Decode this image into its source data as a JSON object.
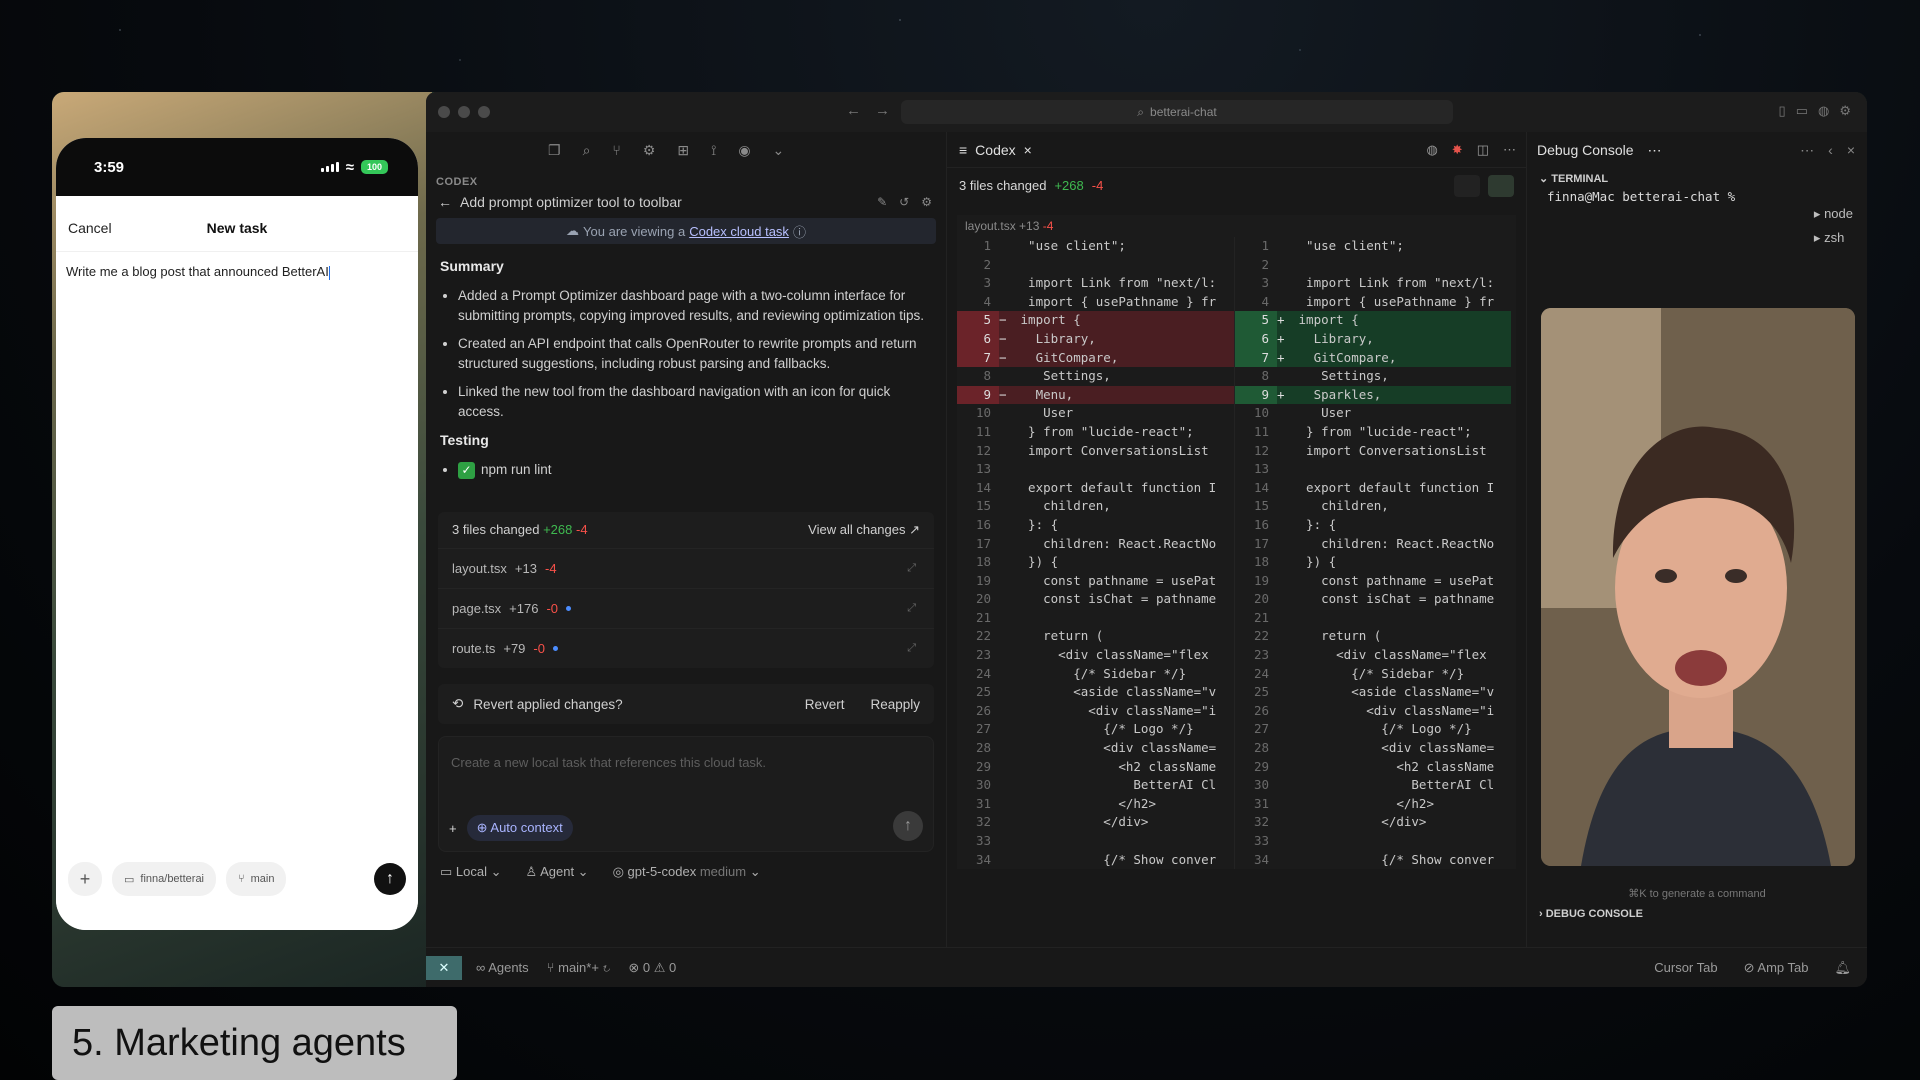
{
  "caption": "5. Marketing agents",
  "phone": {
    "time": "3:59",
    "battery": "100",
    "cancel": "Cancel",
    "title": "New task",
    "prompt": "Write me a blog post that announced BetterAI",
    "repo_chip": "finna/betterai",
    "branch_chip": "main"
  },
  "titlebar": {
    "search": "betterai-chat"
  },
  "codex": {
    "section_label": "CODEX",
    "task_title": "Add prompt optimizer tool to toolbar",
    "cloud_prefix": "You are viewing a",
    "cloud_link": "Codex cloud task",
    "summary_heading": "Summary",
    "summary_items": [
      "Added a Prompt Optimizer dashboard page with a two-column interface for submitting prompts, copying improved results, and reviewing optimization tips.",
      "Created an API endpoint that calls OpenRouter to rewrite prompts and return structured suggestions, including robust parsing and fallbacks.",
      "Linked the new tool from the dashboard navigation with an icon for quick access."
    ],
    "testing_heading": "Testing",
    "testing_item": "npm run lint",
    "files_changed": "3 files changed",
    "files_add": "+268",
    "files_del": "-4",
    "view_all": "View all changes ↗",
    "files": [
      {
        "name": "layout.tsx",
        "add": "+13",
        "del": "-4"
      },
      {
        "name": "page.tsx",
        "add": "+176",
        "del": "-0"
      },
      {
        "name": "route.ts",
        "add": "+79",
        "del": "-0"
      }
    ],
    "revert_question": "Revert applied changes?",
    "revert": "Revert",
    "reapply": "Reapply",
    "compose_placeholder": "Create a new local task that references this cloud task.",
    "auto_context": "Auto context",
    "mode_local": "Local",
    "mode_agent": "Agent",
    "model": "gpt-5-codex",
    "model_effort": "medium"
  },
  "diff": {
    "tab": "Codex",
    "files_changed": "3 files changed",
    "add": "+268",
    "del": "-4",
    "file": "layout.tsx",
    "file_add": "+13",
    "file_del": "-4",
    "left_lines": [
      {
        "n": "1",
        "t": "  \"use client\";",
        "k": ""
      },
      {
        "n": "2",
        "t": "",
        "k": ""
      },
      {
        "n": "3",
        "t": "  import Link from \"next/l:",
        "k": ""
      },
      {
        "n": "4",
        "t": "  import { usePathname } fr",
        "k": ""
      },
      {
        "n": "5",
        "t": " import {",
        "k": "rem"
      },
      {
        "n": "6",
        "t": "   Library,",
        "k": "rem"
      },
      {
        "n": "7",
        "t": "   GitCompare,",
        "k": "rem"
      },
      {
        "n": "8",
        "t": "    Settings,",
        "k": ""
      },
      {
        "n": "9",
        "t": "   Menu,",
        "k": "rem"
      },
      {
        "n": "10",
        "t": "    User",
        "k": ""
      },
      {
        "n": "11",
        "t": "  } from \"lucide-react\";",
        "k": ""
      },
      {
        "n": "12",
        "t": "  import ConversationsList",
        "k": ""
      },
      {
        "n": "13",
        "t": "",
        "k": ""
      },
      {
        "n": "14",
        "t": "  export default function I",
        "k": ""
      },
      {
        "n": "15",
        "t": "    children,",
        "k": ""
      },
      {
        "n": "16",
        "t": "  }: {",
        "k": ""
      },
      {
        "n": "17",
        "t": "    children: React.ReactNo",
        "k": ""
      },
      {
        "n": "18",
        "t": "  }) {",
        "k": ""
      },
      {
        "n": "19",
        "t": "    const pathname = usePat",
        "k": ""
      },
      {
        "n": "20",
        "t": "    const isChat = pathname",
        "k": ""
      },
      {
        "n": "21",
        "t": "",
        "k": ""
      },
      {
        "n": "22",
        "t": "    return (",
        "k": ""
      },
      {
        "n": "23",
        "t": "      <div className=\"flex",
        "k": ""
      },
      {
        "n": "24",
        "t": "        {/* Sidebar */}",
        "k": ""
      },
      {
        "n": "25",
        "t": "        <aside className=\"v",
        "k": ""
      },
      {
        "n": "26",
        "t": "          <div className=\"i",
        "k": ""
      },
      {
        "n": "27",
        "t": "            {/* Logo */}",
        "k": ""
      },
      {
        "n": "28",
        "t": "            <div className=",
        "k": ""
      },
      {
        "n": "29",
        "t": "              <h2 className",
        "k": ""
      },
      {
        "n": "30",
        "t": "                BetterAI Cl",
        "k": ""
      },
      {
        "n": "31",
        "t": "              </h2>",
        "k": ""
      },
      {
        "n": "32",
        "t": "            </div>",
        "k": ""
      },
      {
        "n": "33",
        "t": "",
        "k": ""
      },
      {
        "n": "34",
        "t": "            {/* Show conver",
        "k": ""
      }
    ],
    "right_lines": [
      {
        "n": "1",
        "t": "  \"use client\";",
        "k": ""
      },
      {
        "n": "2",
        "t": "",
        "k": ""
      },
      {
        "n": "3",
        "t": "  import Link from \"next/l:",
        "k": ""
      },
      {
        "n": "4",
        "t": "  import { usePathname } fr",
        "k": ""
      },
      {
        "n": "5",
        "t": " import {",
        "k": "add"
      },
      {
        "n": "6",
        "t": "   Library,",
        "k": "add"
      },
      {
        "n": "7",
        "t": "   GitCompare,",
        "k": "add"
      },
      {
        "n": "8",
        "t": "    Settings,",
        "k": ""
      },
      {
        "n": "9",
        "t": "   Sparkles,",
        "k": "add"
      },
      {
        "n": "10",
        "t": "    User",
        "k": ""
      },
      {
        "n": "11",
        "t": "  } from \"lucide-react\";",
        "k": ""
      },
      {
        "n": "12",
        "t": "  import ConversationsList",
        "k": ""
      },
      {
        "n": "13",
        "t": "",
        "k": ""
      },
      {
        "n": "14",
        "t": "  export default function I",
        "k": ""
      },
      {
        "n": "15",
        "t": "    children,",
        "k": ""
      },
      {
        "n": "16",
        "t": "  }: {",
        "k": ""
      },
      {
        "n": "17",
        "t": "    children: React.ReactNo",
        "k": ""
      },
      {
        "n": "18",
        "t": "  }) {",
        "k": ""
      },
      {
        "n": "19",
        "t": "    const pathname = usePat",
        "k": ""
      },
      {
        "n": "20",
        "t": "    const isChat = pathname",
        "k": ""
      },
      {
        "n": "21",
        "t": "",
        "k": ""
      },
      {
        "n": "22",
        "t": "    return (",
        "k": ""
      },
      {
        "n": "23",
        "t": "      <div className=\"flex",
        "k": ""
      },
      {
        "n": "24",
        "t": "        {/* Sidebar */}",
        "k": ""
      },
      {
        "n": "25",
        "t": "        <aside className=\"v",
        "k": ""
      },
      {
        "n": "26",
        "t": "          <div className=\"i",
        "k": ""
      },
      {
        "n": "27",
        "t": "            {/* Logo */}",
        "k": ""
      },
      {
        "n": "28",
        "t": "            <div className=",
        "k": ""
      },
      {
        "n": "29",
        "t": "              <h2 className",
        "k": ""
      },
      {
        "n": "30",
        "t": "                BetterAI Cl",
        "k": ""
      },
      {
        "n": "31",
        "t": "              </h2>",
        "k": ""
      },
      {
        "n": "32",
        "t": "            </div>",
        "k": ""
      },
      {
        "n": "33",
        "t": "",
        "k": ""
      },
      {
        "n": "34",
        "t": "            {/* Show conver",
        "k": ""
      }
    ]
  },
  "right_panel": {
    "tab": "Debug Console",
    "terminal_label": "TERMINAL",
    "prompt_line": "finna@Mac betterai-chat %",
    "terminals": [
      "node",
      "zsh"
    ],
    "gen_hint": "⌘K to generate a command",
    "debug_label": "DEBUG CONSOLE"
  },
  "statusbar": {
    "agents": "Agents",
    "branch": "main*+",
    "errors": "0",
    "warnings": "0",
    "cursor_tab": "Cursor Tab",
    "amp_tab": "Amp Tab"
  },
  "colors": {
    "add": "#3fb950",
    "del": "#f85149",
    "accent": "#4c8dff"
  }
}
